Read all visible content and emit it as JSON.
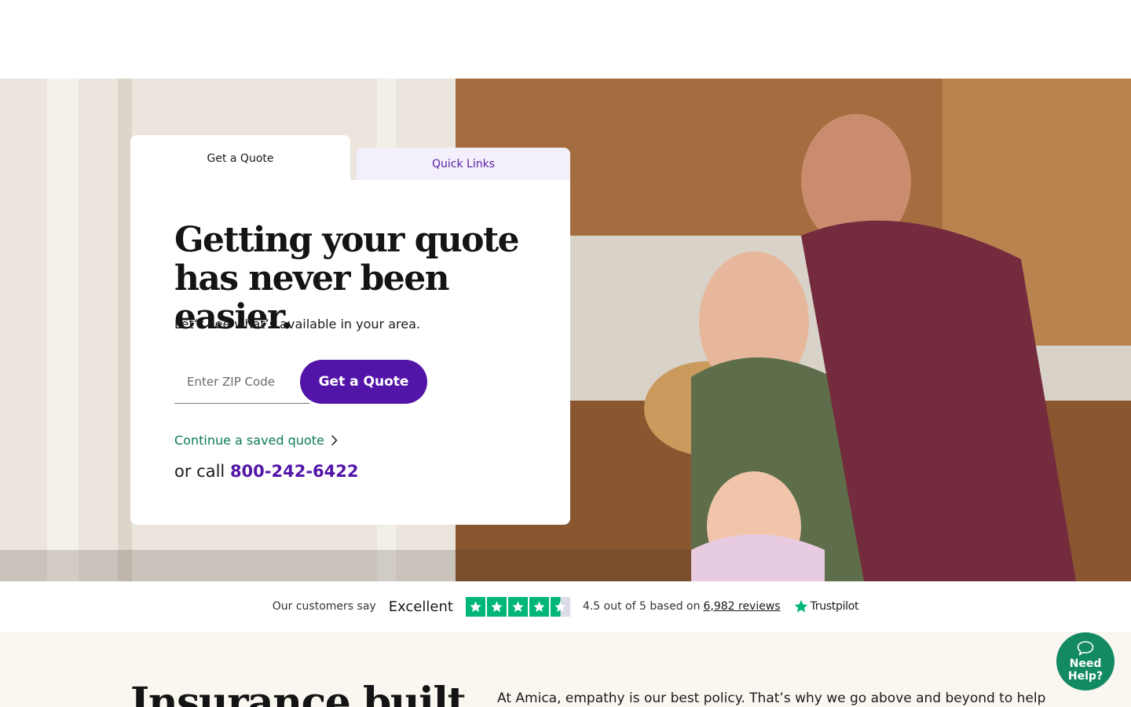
{
  "colors": {
    "brand_purple": "#5315a8",
    "link_green": "#0b7a55",
    "trustpilot_green": "#00b67a",
    "help_green": "#138a62",
    "tab_tint": "#f3effb",
    "bottom_bg": "#faf7f1"
  },
  "tabs": {
    "quote": "Get a Quote",
    "links": "Quick Links"
  },
  "card": {
    "title_line1": "Getting your quote",
    "title_line2": "has never been easier.",
    "subtitle": "Let’s see what’s available in your area.",
    "zip_placeholder": "Enter ZIP Code",
    "zip_value": "",
    "button": "Get a Quote",
    "saved_link": "Continue a saved quote",
    "call_prefix": "or call",
    "phone": "800-242-6422"
  },
  "rating": {
    "customers_say": "Our customers say",
    "excellent": "Excellent",
    "stars": 4.5,
    "score_text": "4.5 out of 5 based on",
    "reviews_link": "6,982 reviews",
    "brand": "Trustpilot"
  },
  "bottom": {
    "heading": "Insurance built",
    "text": "At Amica, empathy is our best policy. That’s why we go above and beyond to help"
  },
  "help": {
    "line1": "Need",
    "line2": "Help?"
  },
  "icons": {
    "chevron": "chevron-right-icon",
    "star": "star-icon",
    "chat": "chat-bubble-icon",
    "trustpilot": "trustpilot-star-icon"
  }
}
